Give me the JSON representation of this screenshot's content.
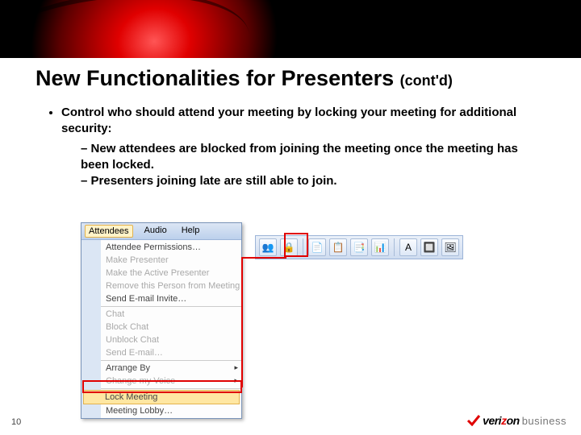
{
  "slide": {
    "title_main": "New Functionalities for Presenters ",
    "title_suffix": "(cont'd)",
    "page_number": "10"
  },
  "bullets": {
    "main": "Control who should attend your meeting by locking your meeting for additional security:",
    "sub1": "New attendees are blocked from joining the meeting once the meeting has been locked.",
    "sub2": "Presenters joining late are still able to join."
  },
  "menubar": {
    "attendees": "Attendees",
    "audio": "Audio",
    "help": "Help"
  },
  "menu": {
    "permissions": "Attendee Permissions…",
    "make_presenter": "Make Presenter",
    "make_active": "Make the Active Presenter",
    "remove": "Remove this Person from Meeting",
    "send_invite": "Send E-mail Invite…",
    "chat": "Chat",
    "block_chat": "Block Chat",
    "unblock_chat": "Unblock Chat",
    "send_email": "Send E-mail…",
    "arrange_by": "Arrange By",
    "change_voice": "Change my Voice",
    "lock_meeting": "Lock Meeting",
    "meeting_lobby": "Meeting Lobby…"
  },
  "toolbar_icons": {
    "i0": "👥",
    "i1": "🔒",
    "i2": "📄",
    "i3": "📋",
    "i4": "📑",
    "i5": "📊",
    "i6": "A",
    "i7": "🔲",
    "i8": "🖼"
  },
  "logo": {
    "brand_prefix": "veri",
    "brand_z": "z",
    "brand_suffix": "on",
    "sub": "business"
  }
}
